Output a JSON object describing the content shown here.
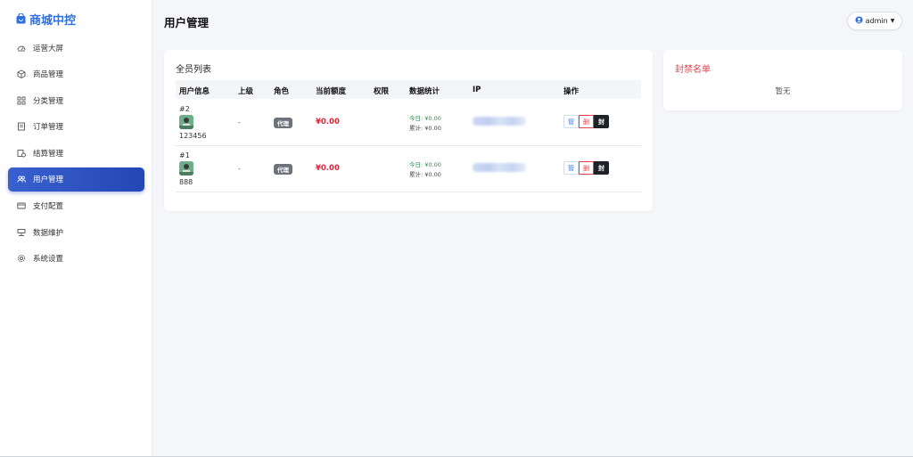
{
  "brand": {
    "name": "商城中控",
    "color": "#2f6fe0"
  },
  "sidebar": {
    "items": [
      {
        "label": "运营大屏",
        "icon": "dashboard-icon",
        "active": false
      },
      {
        "label": "商品管理",
        "icon": "box-icon",
        "active": false
      },
      {
        "label": "分类管理",
        "icon": "grid-icon",
        "active": false
      },
      {
        "label": "订单管理",
        "icon": "order-icon",
        "active": false
      },
      {
        "label": "结算管理",
        "icon": "settlement-icon",
        "active": false
      },
      {
        "label": "用户管理",
        "icon": "users-icon",
        "active": true
      },
      {
        "label": "支付配置",
        "icon": "card-icon",
        "active": false
      },
      {
        "label": "数据维护",
        "icon": "database-icon",
        "active": false
      },
      {
        "label": "系统设置",
        "icon": "gear-icon",
        "active": false
      }
    ]
  },
  "header": {
    "title": "用户管理",
    "user_menu_label": "admin"
  },
  "members": {
    "title": "全员列表",
    "columns": [
      "用户信息",
      "上级",
      "角色",
      "当前额度",
      "权限",
      "数据统计",
      "IP",
      "操作"
    ],
    "rows": [
      {
        "id": "#2",
        "username": "123456",
        "parent": "-",
        "role": "代理",
        "balance": "¥0.00",
        "permission": "",
        "stat_today": "今日: ¥0.00",
        "stat_total": "累计: ¥0.00",
        "ip": "",
        "actions": [
          "管",
          "删",
          "封"
        ]
      },
      {
        "id": "#1",
        "username": "888",
        "parent": "-",
        "role": "代理",
        "balance": "¥0.00",
        "permission": "",
        "stat_today": "今日: ¥0.00",
        "stat_total": "累计: ¥0.00",
        "ip": "",
        "actions": [
          "管",
          "删",
          "封"
        ]
      }
    ]
  },
  "ban_list": {
    "title": "封禁名单",
    "empty_text": "暂无"
  },
  "colors": {
    "accent": "#2f6fe0",
    "active_nav": "#2347b5",
    "danger": "#e0434e",
    "success": "#2e8b4a"
  }
}
